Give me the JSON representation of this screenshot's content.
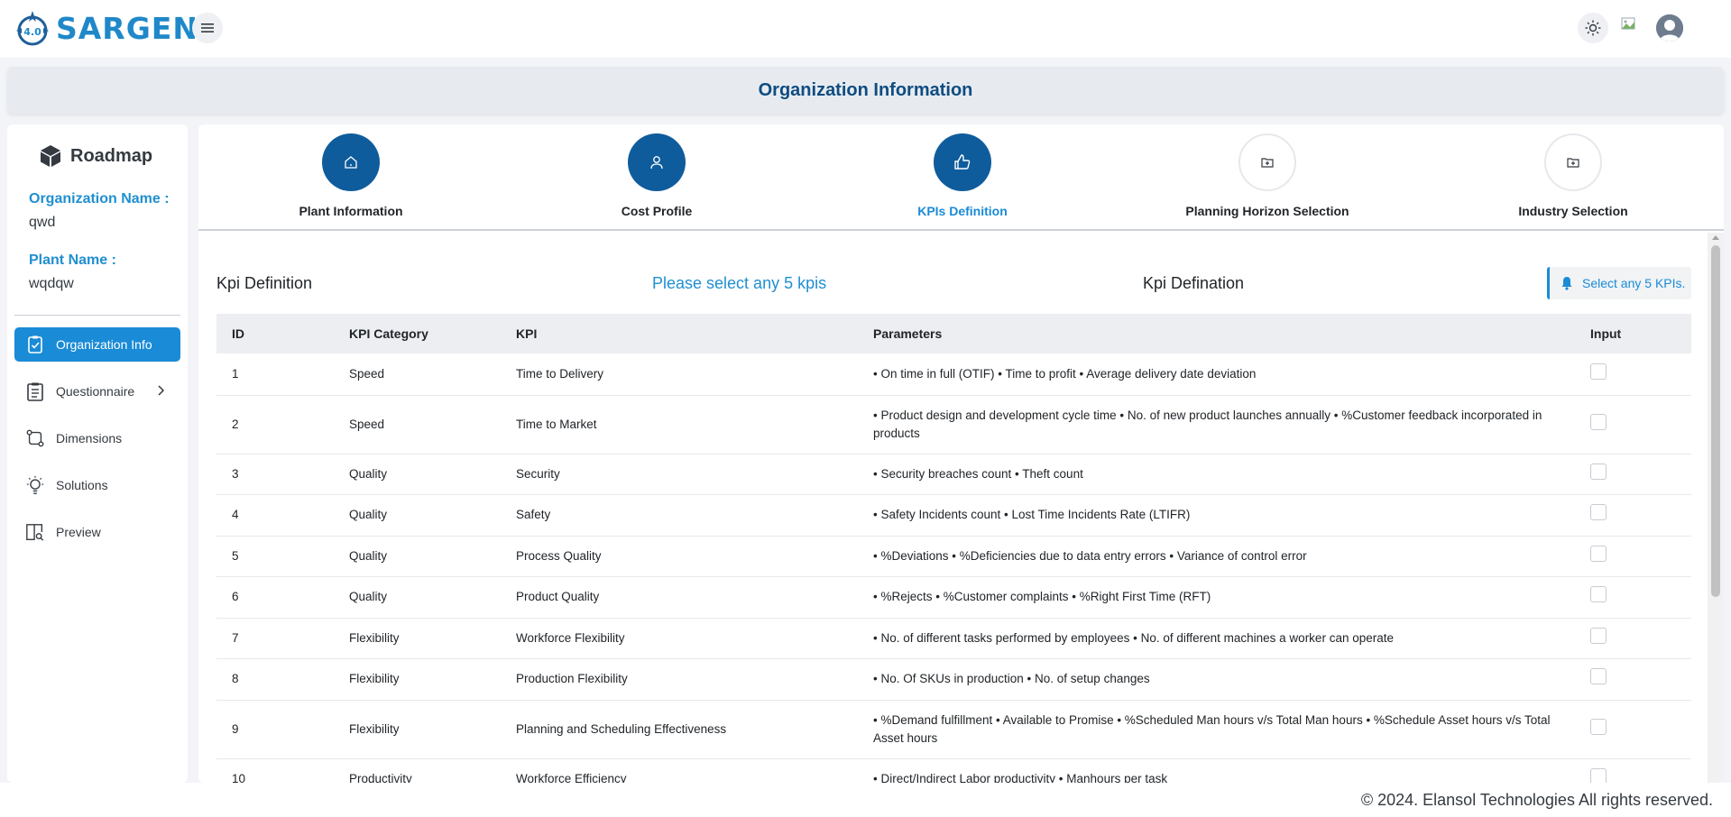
{
  "app": {
    "logo_text": "SARGEN",
    "logo_badge": "4.0"
  },
  "banner": {
    "title": "Organization Information"
  },
  "sidebar": {
    "title": "Roadmap",
    "org_label": "Organization Name :",
    "org_value": "qwd",
    "plant_label": "Plant Name :",
    "plant_value": "wqdqw",
    "items": [
      {
        "label": "Organization Info",
        "icon": "clipboard-check-icon",
        "active": true
      },
      {
        "label": "Questionnaire",
        "icon": "clipboard-list-icon",
        "active": false
      },
      {
        "label": "Dimensions",
        "icon": "git-compare-icon",
        "active": false
      },
      {
        "label": "Solutions",
        "icon": "lightbulb-icon",
        "active": false
      },
      {
        "label": "Preview",
        "icon": "book-search-icon",
        "active": false
      }
    ]
  },
  "steps": [
    {
      "label": "Plant Information",
      "icon": "home-icon",
      "state": "done"
    },
    {
      "label": "Cost Profile",
      "icon": "user-icon",
      "state": "done"
    },
    {
      "label": "KPIs Definition",
      "icon": "thumbs-up-icon",
      "state": "current"
    },
    {
      "label": "Planning Horizon Selection",
      "icon": "folder-plus-icon",
      "state": "pending"
    },
    {
      "label": "Industry Selection",
      "icon": "folder-plus-icon",
      "state": "pending"
    }
  ],
  "kpi_section": {
    "title": "Kpi Definition",
    "prompt": "Please select any 5 kpis",
    "subtitle": "Kpi Defination",
    "alert": "Select any 5 KPIs."
  },
  "table": {
    "headers": [
      "ID",
      "KPI Category",
      "KPI",
      "Parameters",
      "Input"
    ],
    "rows": [
      {
        "id": "1",
        "category": "Speed",
        "kpi": "Time to Delivery",
        "params": "• On time in full (OTIF) • Time to profit • Average delivery date deviation",
        "checked": false
      },
      {
        "id": "2",
        "category": "Speed",
        "kpi": "Time to Market",
        "params": "• Product design and development cycle time • No. of new product launches annually • %Customer feedback incorporated in products",
        "checked": false
      },
      {
        "id": "3",
        "category": "Quality",
        "kpi": "Security",
        "params": "• Security breaches count • Theft count",
        "checked": false
      },
      {
        "id": "4",
        "category": "Quality",
        "kpi": "Safety",
        "params": "• Safety Incidents count • Lost Time Incidents Rate (LTIFR)",
        "checked": false
      },
      {
        "id": "5",
        "category": "Quality",
        "kpi": "Process Quality",
        "params": "• %Deviations • %Deficiencies due to data entry errors • Variance of control error",
        "checked": false
      },
      {
        "id": "6",
        "category": "Quality",
        "kpi": "Product Quality",
        "params": "• %Rejects • %Customer complaints • %Right First Time (RFT)",
        "checked": false
      },
      {
        "id": "7",
        "category": "Flexibility",
        "kpi": "Workforce Flexibility",
        "params": "• No. of different tasks performed by employees • No. of different machines a worker can operate",
        "checked": false
      },
      {
        "id": "8",
        "category": "Flexibility",
        "kpi": "Production Flexibility",
        "params": "• No. Of SKUs in production • No. of setup changes",
        "checked": false
      },
      {
        "id": "9",
        "category": "Flexibility",
        "kpi": "Planning and Scheduling Effectiveness",
        "params": "• %Demand fulfillment • Available to Promise • %Scheduled Man hours v/s Total Man hours • %Schedule Asset hours v/s Total Asset hours",
        "checked": false
      },
      {
        "id": "10",
        "category": "Productivity",
        "kpi": "Workforce Efficiency",
        "params": "• Direct/Indirect Labor productivity • Manhours per task",
        "checked": false
      }
    ]
  },
  "footer": {
    "text": "© 2024. Elansol Technologies All rights reserved."
  },
  "colors": {
    "primary": "#1a8bd6",
    "step_done": "#0f5c9c",
    "title": "#0f4c81"
  }
}
